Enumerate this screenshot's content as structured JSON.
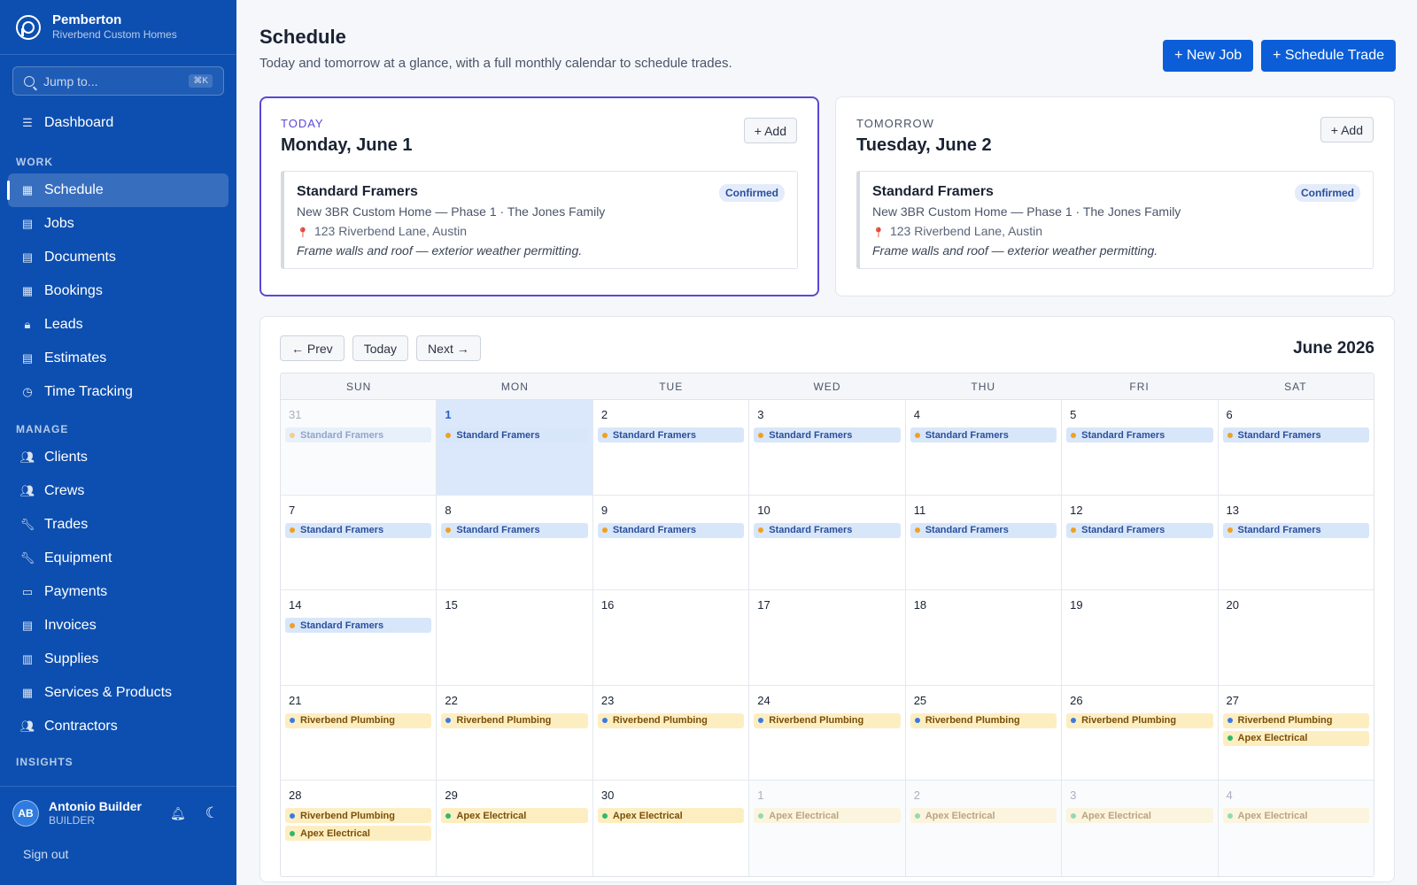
{
  "brand": {
    "name": "Pemberton",
    "sub": "Riverbend Custom Homes"
  },
  "search": {
    "placeholder": "Jump to...",
    "shortcut": "⌘K"
  },
  "nav": {
    "dashboard": "Dashboard",
    "work_label": "WORK",
    "work": [
      {
        "label": "Schedule",
        "icon": "calendar-icon",
        "active": true
      },
      {
        "label": "Jobs",
        "icon": "briefcase-icon"
      },
      {
        "label": "Documents",
        "icon": "document-icon"
      },
      {
        "label": "Bookings",
        "icon": "calendar-icon"
      },
      {
        "label": "Leads",
        "icon": "lock-icon"
      },
      {
        "label": "Estimates",
        "icon": "document-icon"
      },
      {
        "label": "Time Tracking",
        "icon": "clock-icon"
      }
    ],
    "manage_label": "MANAGE",
    "manage": [
      {
        "label": "Clients",
        "icon": "users-icon"
      },
      {
        "label": "Crews",
        "icon": "users-icon"
      },
      {
        "label": "Trades",
        "icon": "wrench-icon"
      },
      {
        "label": "Equipment",
        "icon": "wrench-icon"
      },
      {
        "label": "Payments",
        "icon": "card-icon"
      },
      {
        "label": "Invoices",
        "icon": "document-icon"
      },
      {
        "label": "Supplies",
        "icon": "box-icon"
      },
      {
        "label": "Services & Products",
        "icon": "grid-icon"
      },
      {
        "label": "Contractors",
        "icon": "users-icon"
      }
    ],
    "insights_label": "INSIGHTS"
  },
  "user": {
    "initials": "AB",
    "name": "Antonio Builder",
    "role": "BUILDER",
    "signout": "Sign out"
  },
  "header": {
    "title": "Schedule",
    "subtitle": "Today and tomorrow at a glance, with a full monthly calendar to schedule trades.",
    "new_job": "+ New Job",
    "schedule_trade": "+ Schedule Trade"
  },
  "today": {
    "kicker": "TODAY",
    "date": "Monday, June 1",
    "add": "+ Add",
    "job": {
      "title": "Standard Framers",
      "badge": "Confirmed",
      "project": "New 3BR Custom Home — Phase 1 · The Jones Family",
      "address": "123 Riverbend Lane, Austin",
      "note": "Frame walls and roof — exterior weather permitting."
    }
  },
  "tomorrow": {
    "kicker": "TOMORROW",
    "date": "Tuesday, June 2",
    "add": "+ Add",
    "job": {
      "title": "Standard Framers",
      "badge": "Confirmed",
      "project": "New 3BR Custom Home — Phase 1 · The Jones Family",
      "address": "123 Riverbend Lane, Austin",
      "note": "Frame walls and roof — exterior weather permitting."
    }
  },
  "calendar": {
    "prev": "← Prev",
    "today": "Today",
    "next": "Next →",
    "month": "June 2026",
    "weekdays": [
      "SUN",
      "MON",
      "TUE",
      "WED",
      "THU",
      "FRI",
      "SAT"
    ],
    "colors": {
      "framers_dot": "#f0a020",
      "plumbing_dot": "#3b7be0",
      "electrical_dot": "#2eb86a"
    },
    "weeks": [
      [
        {
          "d": "31",
          "other": true,
          "ev": [
            [
              "Standard Framers",
              "framers"
            ]
          ]
        },
        {
          "d": "1",
          "sel": true,
          "ev": [
            [
              "Standard Framers",
              "framers"
            ]
          ]
        },
        {
          "d": "2",
          "ev": [
            [
              "Standard Framers",
              "framers"
            ]
          ]
        },
        {
          "d": "3",
          "ev": [
            [
              "Standard Framers",
              "framers"
            ]
          ]
        },
        {
          "d": "4",
          "ev": [
            [
              "Standard Framers",
              "framers"
            ]
          ]
        },
        {
          "d": "5",
          "ev": [
            [
              "Standard Framers",
              "framers"
            ]
          ]
        },
        {
          "d": "6",
          "ev": [
            [
              "Standard Framers",
              "framers"
            ]
          ]
        }
      ],
      [
        {
          "d": "7",
          "ev": [
            [
              "Standard Framers",
              "framers"
            ]
          ]
        },
        {
          "d": "8",
          "ev": [
            [
              "Standard Framers",
              "framers"
            ]
          ]
        },
        {
          "d": "9",
          "ev": [
            [
              "Standard Framers",
              "framers"
            ]
          ]
        },
        {
          "d": "10",
          "ev": [
            [
              "Standard Framers",
              "framers"
            ]
          ]
        },
        {
          "d": "11",
          "ev": [
            [
              "Standard Framers",
              "framers"
            ]
          ]
        },
        {
          "d": "12",
          "ev": [
            [
              "Standard Framers",
              "framers"
            ]
          ]
        },
        {
          "d": "13",
          "ev": [
            [
              "Standard Framers",
              "framers"
            ]
          ]
        }
      ],
      [
        {
          "d": "14",
          "ev": [
            [
              "Standard Framers",
              "framers"
            ]
          ]
        },
        {
          "d": "15",
          "ev": []
        },
        {
          "d": "16",
          "ev": []
        },
        {
          "d": "17",
          "ev": []
        },
        {
          "d": "18",
          "ev": []
        },
        {
          "d": "19",
          "ev": []
        },
        {
          "d": "20",
          "ev": []
        }
      ],
      [
        {
          "d": "21",
          "ev": [
            [
              "Riverbend Plumbing",
              "plumbing"
            ]
          ]
        },
        {
          "d": "22",
          "ev": [
            [
              "Riverbend Plumbing",
              "plumbing"
            ]
          ]
        },
        {
          "d": "23",
          "ev": [
            [
              "Riverbend Plumbing",
              "plumbing"
            ]
          ]
        },
        {
          "d": "24",
          "ev": [
            [
              "Riverbend Plumbing",
              "plumbing"
            ]
          ]
        },
        {
          "d": "25",
          "ev": [
            [
              "Riverbend Plumbing",
              "plumbing"
            ]
          ]
        },
        {
          "d": "26",
          "ev": [
            [
              "Riverbend Plumbing",
              "plumbing"
            ]
          ]
        },
        {
          "d": "27",
          "ev": [
            [
              "Riverbend Plumbing",
              "plumbing"
            ],
            [
              "Apex Electrical",
              "electrical"
            ]
          ]
        }
      ],
      [
        {
          "d": "28",
          "ev": [
            [
              "Riverbend Plumbing",
              "plumbing"
            ],
            [
              "Apex Electrical",
              "electrical"
            ]
          ]
        },
        {
          "d": "29",
          "ev": [
            [
              "Apex Electrical",
              "electrical"
            ]
          ]
        },
        {
          "d": "30",
          "ev": [
            [
              "Apex Electrical",
              "electrical"
            ]
          ]
        },
        {
          "d": "1",
          "other": true,
          "ev": [
            [
              "Apex Electrical",
              "electrical"
            ]
          ]
        },
        {
          "d": "2",
          "other": true,
          "ev": [
            [
              "Apex Electrical",
              "electrical"
            ]
          ]
        },
        {
          "d": "3",
          "other": true,
          "ev": [
            [
              "Apex Electrical",
              "electrical"
            ]
          ]
        },
        {
          "d": "4",
          "other": true,
          "ev": [
            [
              "Apex Electrical",
              "electrical"
            ]
          ]
        }
      ]
    ]
  }
}
